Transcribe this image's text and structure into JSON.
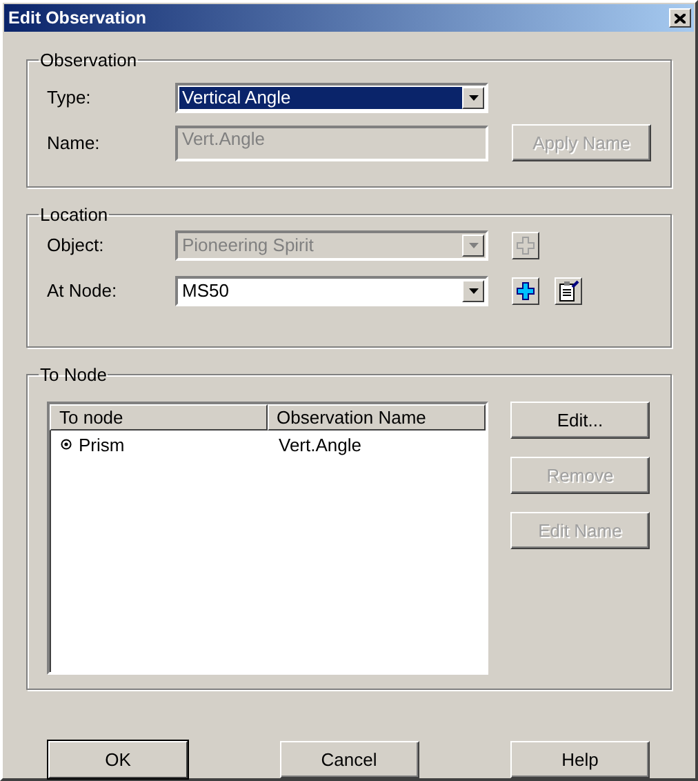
{
  "window": {
    "title": "Edit Observation"
  },
  "observation": {
    "title": "Observation",
    "type": {
      "label": "Type:",
      "value": "Vertical Angle",
      "highlighted": true,
      "disabled": false
    },
    "name": {
      "label": "Name:",
      "value": "Vert.Angle",
      "disabled": true
    },
    "apply_button": {
      "label": "Apply Name",
      "disabled": true
    }
  },
  "location": {
    "title": "Location",
    "object": {
      "label": "Object:",
      "value": "Pioneering Spirit",
      "disabled": true,
      "highlighted": false
    },
    "at_node": {
      "label": "At Node:",
      "value": "MS50",
      "disabled": false,
      "highlighted": false
    }
  },
  "to_node": {
    "title": "To Node",
    "columns": [
      "To node",
      "Observation Name"
    ],
    "rows": [
      {
        "to_node": "Prism",
        "observation_name": "Vert.Angle"
      }
    ],
    "buttons": [
      {
        "label": "Edit...",
        "disabled": false
      },
      {
        "label": "Remove",
        "disabled": true
      },
      {
        "label": "Edit Name",
        "disabled": true
      }
    ]
  },
  "buttons": [
    {
      "label": "OK",
      "default": true
    },
    {
      "label": "Cancel",
      "default": false
    },
    {
      "label": "Help",
      "default": false
    }
  ]
}
